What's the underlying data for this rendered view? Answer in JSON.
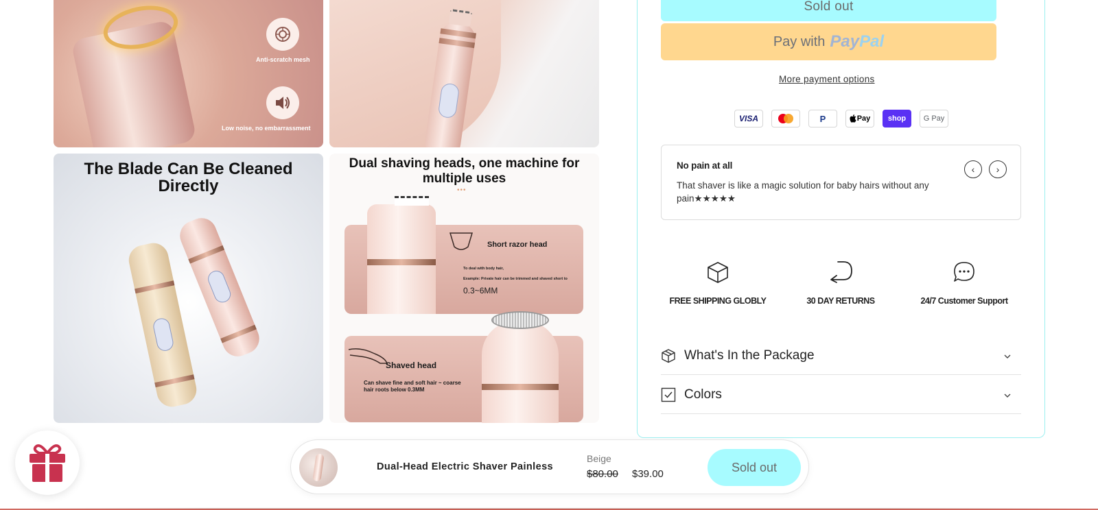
{
  "gallery": {
    "tile1": {
      "caption_mesh": "Anti-scratch mesh",
      "caption_noise": "Low noise, no embarrassment",
      "icon_mesh": "mesh-icon",
      "icon_sound": "speaker-icon"
    },
    "tile3": {
      "title": "The Blade Can Be Cleaned Directly"
    },
    "tile4": {
      "title": "Dual shaving heads, one machine for multiple uses",
      "panel1_heading": "Short razor head",
      "panel1_line1": "To deal with body hair,",
      "panel1_line2": "Example: Private hair can be trimmed and shaved short to",
      "panel1_range": "0.3~6MM",
      "panel2_heading": "Shaved head",
      "panel2_text": "Can shave fine and soft hair ~ coarse hair roots below 0.3MM"
    }
  },
  "product": {
    "sold_out_label": "Sold out",
    "paypal_prefix": "Pay with",
    "paypal_brand_1": "Pay",
    "paypal_brand_2": "Pal",
    "more_payment_options": "More payment options",
    "payment_methods": [
      {
        "name": "visa-card-icon",
        "label": "VISA"
      },
      {
        "name": "mastercard-icon",
        "label": ""
      },
      {
        "name": "paypal-card-icon",
        "label": "P"
      },
      {
        "name": "apple-pay-icon",
        "label": "Pay"
      },
      {
        "name": "shop-pay-icon",
        "label": "shop"
      },
      {
        "name": "google-pay-icon",
        "label": "G Pay"
      }
    ],
    "review": {
      "title": "No pain at all",
      "text": "That shaver is like a magic solution for baby hairs without any pain★★★★★",
      "prev_icon": "chevron-left-icon",
      "next_icon": "chevron-right-icon"
    },
    "features": [
      {
        "icon": "box-icon",
        "label": "FREE SHIPPING GLOBLY"
      },
      {
        "icon": "return-arrow-icon",
        "label": "30 DAY RETURNS"
      },
      {
        "icon": "chat-bubble-icon",
        "label": "24/7 Customer Support"
      }
    ],
    "accordions": [
      {
        "icon": "package-icon",
        "label": "What's In the Package"
      },
      {
        "icon": "checkbox-icon",
        "label": "Colors"
      }
    ]
  },
  "sticky_bar": {
    "product_name": "Dual-Head Electric Shaver Painless",
    "variant": "Beige",
    "compare_price": "$80.00",
    "price": "$39.00",
    "button_label": "Sold out"
  },
  "gift_widget": {
    "icon": "gift-icon"
  },
  "colors": {
    "accent_cyan": "#a7fbff",
    "paypal_yellow": "#ffd78f",
    "shop_pay_purple": "#5a31f4",
    "gift_red": "#c8324f"
  }
}
